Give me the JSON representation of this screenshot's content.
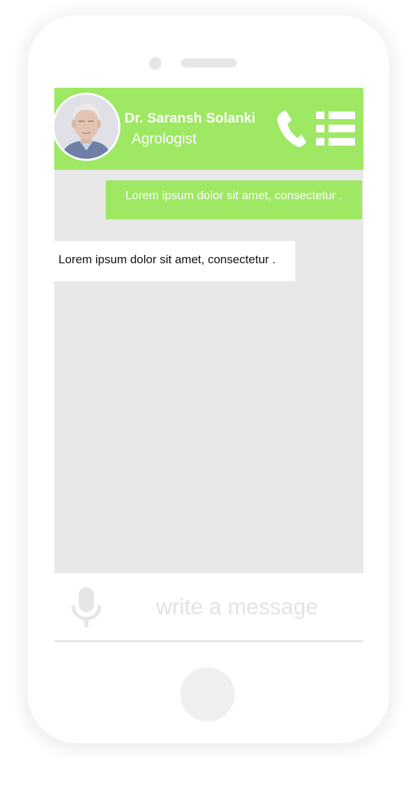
{
  "colors": {
    "accent": "#9ee863",
    "chat_background": "#e8e8e8",
    "incoming_bubble": "#ffffff",
    "icon_muted": "#e6e6e6"
  },
  "header": {
    "avatar_icon": "doctor-avatar",
    "name": "Dr. Saransh Solanki",
    "role": "Agrologist",
    "call_icon": "phone-icon",
    "menu_icon": "list-menu-icon"
  },
  "messages": [
    {
      "direction": "outgoing",
      "text": "Lorem ipsum dolor sit amet, consectetur ."
    },
    {
      "direction": "incoming",
      "text": "Lorem ipsum dolor sit amet, consectetur ."
    }
  ],
  "composer": {
    "mic_icon": "microphone-icon",
    "placeholder": "write a message",
    "value": ""
  }
}
